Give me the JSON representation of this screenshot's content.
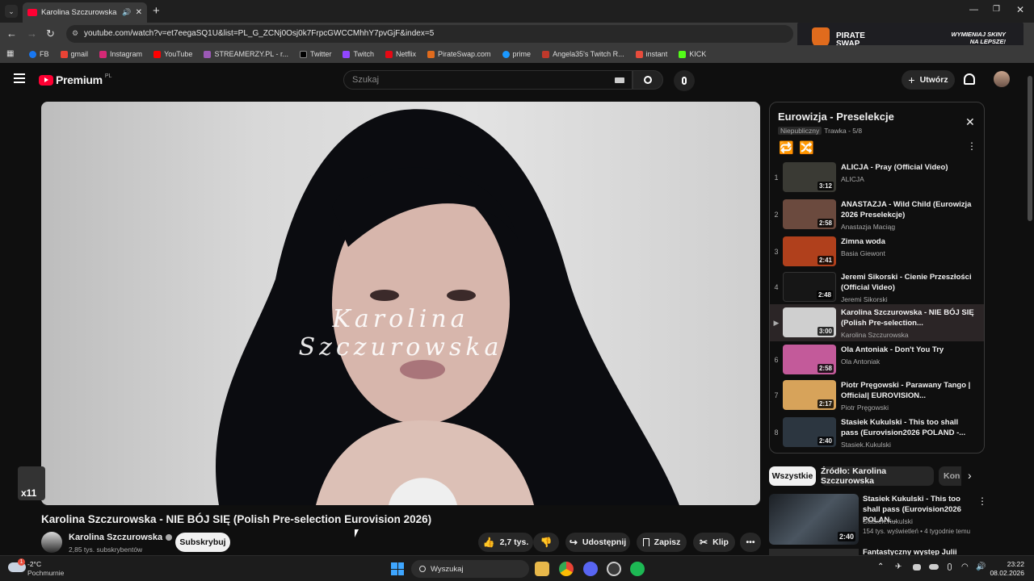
{
  "browser": {
    "tab_title": "Karolina Szczurowska - NIE",
    "url": "youtube.com/watch?v=et7eegaSQ1U&list=PL_G_ZCNj0Osj0k7FrpcGWCCMhhY7pvGjF&index=5",
    "bookmarks": [
      "FB",
      "gmail",
      "Instagram",
      "YouTube",
      "STREAMERZY.PL - r...",
      "Twitter",
      "Twitch",
      "Netflix",
      "PirateSwap.com",
      "prime",
      "Angela35's Twitch R...",
      "instant",
      "KICK"
    ],
    "ad": {
      "brand": "PIRATE SWAP",
      "slogan_1": "WYMIENIAJ SKINY",
      "slogan_2": "NA LEPSZE!"
    }
  },
  "youtube": {
    "logo": "Premium",
    "logo_region": "PL",
    "search_placeholder": "Szukaj",
    "create_label": "Utwórz"
  },
  "video": {
    "overlay_signature": "Karolina Szczurowska",
    "title": "Karolina Szczurowska - NIE BÓJ SIĘ (Polish Pre-selection Eurovision 2026)",
    "channel": "Karolina Szczurowska",
    "subscribers": "2,85 tys. subskrybentów",
    "subscribe_label": "Subskrybuj",
    "likes": "2,7 tys.",
    "share_label": "Udostępnij",
    "save_label": "Zapisz",
    "clip_label": "Klip",
    "corner_badge": "x11"
  },
  "playlist": {
    "title": "Eurowizja - Preselekcje",
    "visibility": "Niepubliczny",
    "meta": "Trawka - 5/8",
    "items": [
      {
        "num": "1",
        "title": "ALICJA - Pray (Official Video)",
        "channel": "ALICJA",
        "duration": "3:12",
        "color": "#3a3a34"
      },
      {
        "num": "2",
        "title": "ANASTAZJA - Wild Child (Eurowizja 2026 Preselekcje)",
        "channel": "Anastazja Maciąg",
        "duration": "2:58",
        "color": "#6b4a3e"
      },
      {
        "num": "3",
        "title": "Zimna woda",
        "channel": "Basia Giewont",
        "duration": "2:41",
        "color": "#b0401c"
      },
      {
        "num": "4",
        "title": "Jeremi Sikorski - Cienie Przeszłości (Official Video)",
        "channel": "Jeremi Sikorski",
        "duration": "2:48",
        "color": "#161616"
      },
      {
        "num": "▶",
        "title": "Karolina Szczurowska - NIE BÓJ SIĘ (Polish Pre-selection...",
        "channel": "Karolina Szczurowska",
        "duration": "3:00",
        "color": "#cfcfcf"
      },
      {
        "num": "6",
        "title": "Ola Antoniak - Don't You Try",
        "channel": "Ola Antoniak",
        "duration": "2:58",
        "color": "#c35a9a"
      },
      {
        "num": "7",
        "title": "Piotr Pręgowski - Parawany Tango | Official| EUROVISION...",
        "channel": "Piotr Pręgowski",
        "duration": "2:17",
        "color": "#d7a35a"
      },
      {
        "num": "8",
        "title": "Stasiek Kukulski - This too shall pass (Eurovision2026 POLAND -...",
        "channel": "Stasiek.Kukulski",
        "duration": "2:40",
        "color": "#2c3640"
      }
    ]
  },
  "filters": [
    "Wszystkie",
    "Źródło: Karolina Szczurowska",
    "Kon"
  ],
  "recommended": [
    {
      "title": "Stasiek Kukulski - This too shall pass (Eurovision2026 POLAN...",
      "channel": "Stasiek.Kukulski",
      "meta": "154 tys. wyświetleń • 4 tygodnie temu",
      "duration": "2:40"
    },
    {
      "title": "Fantastyczny występ Julii"
    }
  ],
  "taskbar": {
    "temp": "-2°C",
    "weather": "Pochmurnie",
    "search": "Wyszukaj",
    "time": "23:22",
    "date": "08.02.2026",
    "weather_badge": "1"
  }
}
